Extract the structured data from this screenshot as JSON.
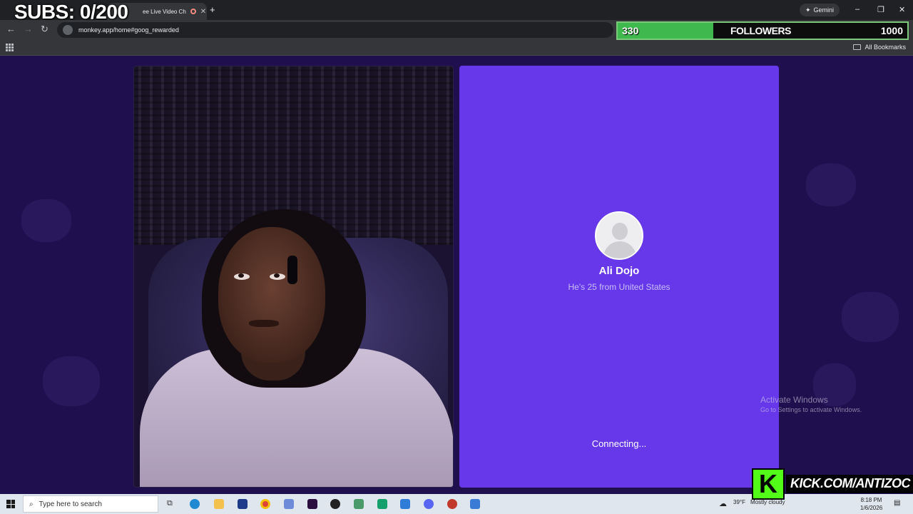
{
  "overlay": {
    "subs": "SUBS: 0/200",
    "followers_count": "330",
    "followers_label": "FOLLOWERS",
    "followers_goal": "1000",
    "followers_progress": 0.33,
    "kick_text": "KICK.COM/ANTIZOC"
  },
  "browser": {
    "tab_title": "ee Live Video Ch",
    "url": "monkey.app/home#goog_rewarded",
    "gemini_label": "Gemini",
    "bookmarks_label": "All Bookmarks"
  },
  "match": {
    "name": "Ali Dojo",
    "info": "He's 25 from United States",
    "status": "Connecting..."
  },
  "watermark": {
    "line1": "Activate Windows",
    "line2": "Go to Settings to activate Windows."
  },
  "taskbar": {
    "search_placeholder": "Type here to search",
    "weather_temp": "39°F",
    "weather_desc": "Mostly cloudy",
    "time": "8:18 PM",
    "date": "1/6/2026"
  },
  "colors": {
    "match_card": "#6638ea",
    "page_bg": "#1f0f4f",
    "followers_fill": "#3fb94d",
    "kick_green": "#53fc18"
  }
}
